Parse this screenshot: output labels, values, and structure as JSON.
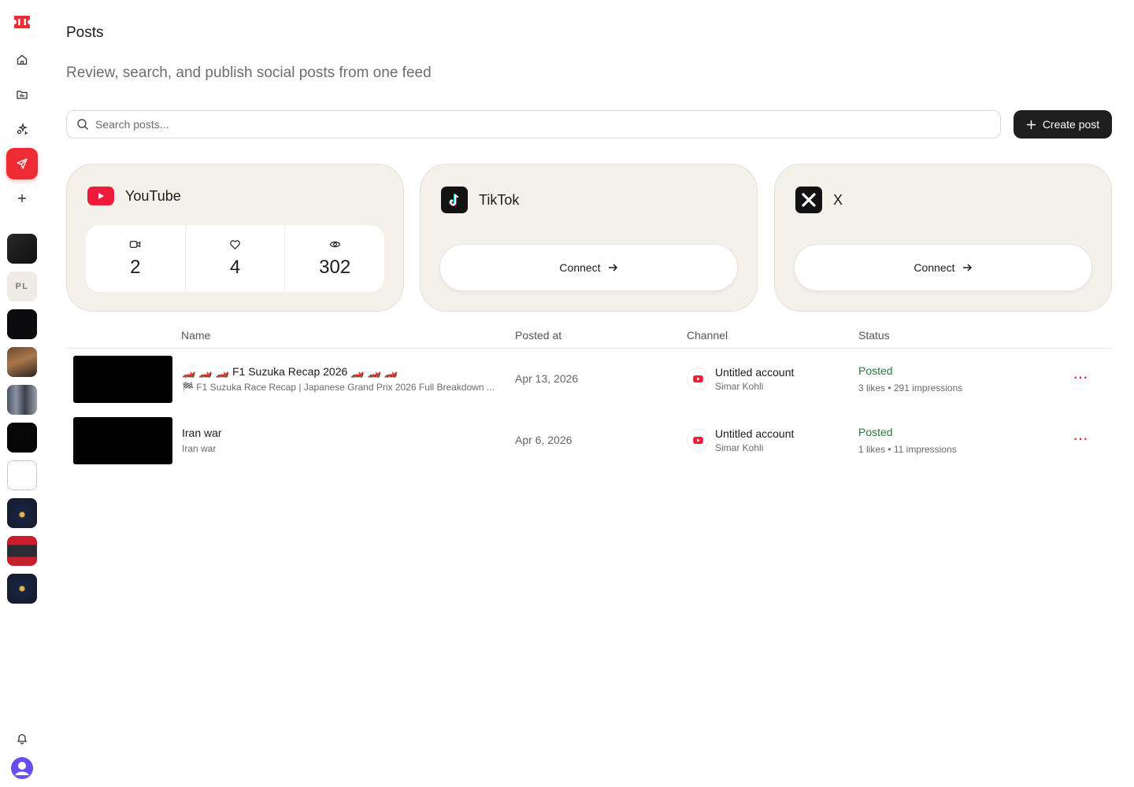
{
  "sidebar": {
    "logo": "brand-ticket-logo",
    "nav": [
      {
        "icon": "home-icon"
      },
      {
        "icon": "folder-icon"
      },
      {
        "icon": "sparkles-icon"
      },
      {
        "icon": "send-icon",
        "active": true
      },
      {
        "icon": "plus-icon"
      }
    ],
    "workspaces": [
      {
        "kind": "thumb"
      },
      {
        "kind": "initials",
        "label": "PL"
      },
      {
        "kind": "thumb"
      },
      {
        "kind": "thumb"
      },
      {
        "kind": "thumb"
      },
      {
        "kind": "thumb"
      },
      {
        "kind": "thumb"
      },
      {
        "kind": "thumb"
      },
      {
        "kind": "thumb"
      },
      {
        "kind": "thumb"
      }
    ],
    "bottom": [
      {
        "icon": "bell-icon"
      },
      {
        "icon": "user-avatar-icon"
      }
    ]
  },
  "header": {
    "title": "Posts",
    "subtitle": "Review, search, and publish social posts from one feed"
  },
  "search": {
    "placeholder": "Search posts..."
  },
  "toolbar": {
    "create_label": "Create post"
  },
  "channels": [
    {
      "name": "YouTube",
      "videos": "2",
      "likes": "4",
      "views": "302"
    },
    {
      "name": "TikTok",
      "connect_label": "Connect"
    },
    {
      "name": "X",
      "connect_label": "Connect"
    }
  ],
  "table": {
    "columns": [
      "Name",
      "Posted at",
      "Channel",
      "Status"
    ],
    "rows": [
      {
        "title": "🏎️ 🏎️ 🏎️ F1 Suzuka Recap 2026 🏎️ 🏎️ 🏎️",
        "subtitle": "🏁 F1 Suzuka Race Recap | Japanese Grand Prix 2026 Full Breakdown ...",
        "posted_at": "Apr 13, 2026",
        "channel_name": "Untitled account",
        "channel_user": "Simar Kohli",
        "status": "Posted",
        "meta": "3 likes • 291 impressions"
      },
      {
        "title": "Iran war",
        "subtitle": "Iran war",
        "posted_at": "Apr 6, 2026",
        "channel_name": "Untitled account",
        "channel_user": "Simar Kohli",
        "status": "Posted",
        "meta": "1 likes • 11 impressions"
      }
    ]
  },
  "colors": {
    "accent": "#ee2a35",
    "status_green": "#2a7a3f",
    "card_bg": "#f4f1ea"
  }
}
